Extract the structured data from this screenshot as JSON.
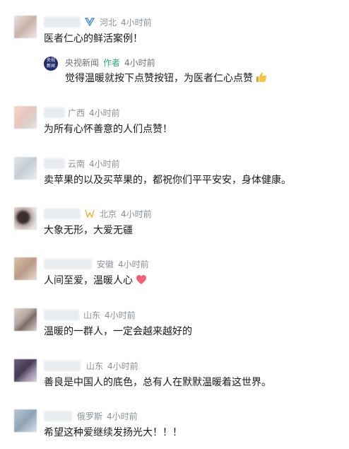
{
  "comments": [
    {
      "location": "河北",
      "time": "4小时前",
      "text": "医者仁心的鲜活案例！",
      "badge": "blue-badge-icon"
    },
    {
      "location": "广西",
      "time": "4小时前",
      "text": "为所有心怀善意的人们点赞！"
    },
    {
      "location": "云南",
      "time": "4小时前",
      "text": "卖苹果的以及买苹果的，都祝你们平平安安，身体健康。"
    },
    {
      "location": "北京",
      "time": "4小时前",
      "text": "大象无形，大爱无疆",
      "badge": "gold-badge-icon"
    },
    {
      "location": "安徽",
      "time": "4小时前",
      "text": "人间至爱，温暖人心",
      "emoji": "heart-emoji-icon"
    },
    {
      "location": "山东",
      "time": "4小时前",
      "text": "温暖的一群人，一定会越来越好的"
    },
    {
      "location": "山东",
      "time": "4小时前",
      "text": "善良是中国人的底色，总有人在默默温暖着这世界。"
    },
    {
      "location": "俄罗斯",
      "time": "4小时前",
      "text": "希望这种爱继续发扬光大！！！"
    }
  ],
  "reply": {
    "name": "央视新闻",
    "tag": "作者",
    "time": "4小时前",
    "text": "觉得温暖就按下点赞按钮，为医者仁心点赞",
    "avatar_text": "央视新闻",
    "emoji": "thumbs-up-emoji-icon"
  },
  "colors": {
    "author_tag": "#2bb06f",
    "meta": "#8a8f99",
    "text": "#1a1a1a"
  }
}
